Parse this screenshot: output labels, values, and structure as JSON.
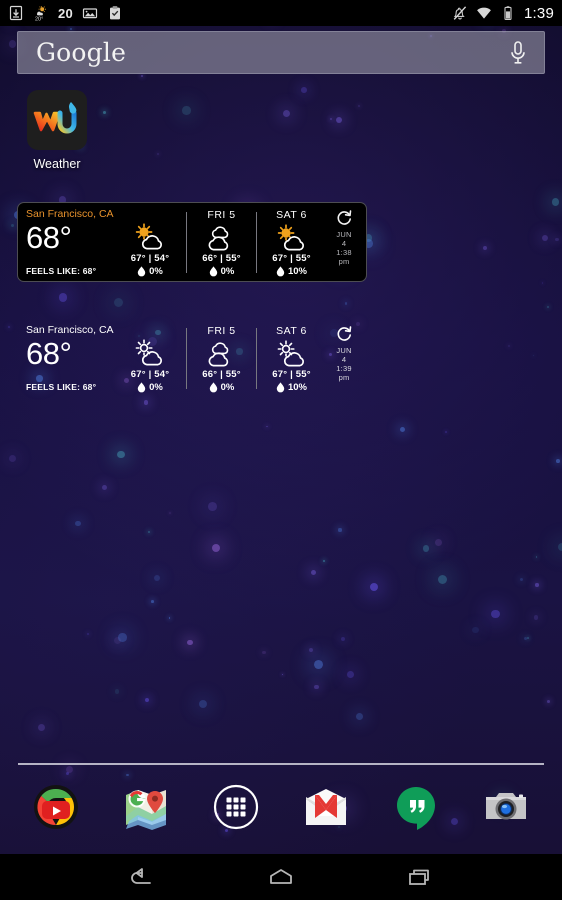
{
  "status_bar": {
    "left_icons": [
      {
        "name": "download-icon",
        "label": "download"
      },
      {
        "name": "weather-notification-icon",
        "label": "20°"
      },
      {
        "name": "notification-count",
        "label": "20"
      },
      {
        "name": "screenshot-icon",
        "label": "screenshot"
      },
      {
        "name": "clipboard-icon",
        "label": "clipboard"
      }
    ],
    "notification_count": "20",
    "weather_temp": "20°",
    "right_icons": [
      {
        "name": "silent-mode-icon",
        "label": "silent"
      },
      {
        "name": "wifi-icon",
        "label": "wifi"
      },
      {
        "name": "battery-icon",
        "label": "battery"
      }
    ],
    "clock": "1:39"
  },
  "search": {
    "brand": "Google",
    "placeholder": "Google",
    "mic_label": "voice-search"
  },
  "apps": [
    {
      "name": "weather-underground",
      "label": "Weather",
      "logo": "wu"
    }
  ],
  "widgets": [
    {
      "id": "widget-opaque",
      "style": "opaque",
      "city": "San Francisco, CA",
      "temp": "68°",
      "feels_like_label": "FEELS LIKE:",
      "feels_like_value": "68°",
      "today_icon": "partly-cloudy",
      "today_hilo": "67° | 54°",
      "today_pop": "0%",
      "refresh_label": "refresh",
      "stamp": [
        "JUN",
        "4",
        "1:38",
        "pm"
      ],
      "days": [
        {
          "name": "FRI  5",
          "icon": "cloudy",
          "hilo": "66° | 55°",
          "pop": "0%"
        },
        {
          "name": "SAT  6",
          "icon": "partly-cloudy",
          "hilo": "67° | 55°",
          "pop": "10%"
        }
      ]
    },
    {
      "id": "widget-clear",
      "style": "transparent",
      "city": "San Francisco, CA",
      "temp": "68°",
      "feels_like_label": "FEELS LIKE:",
      "feels_like_value": "68°",
      "today_icon": "partly-cloudy",
      "today_hilo": "67° | 54°",
      "today_pop": "0%",
      "refresh_label": "refresh",
      "stamp": [
        "JUN",
        "4",
        "1:39",
        "pm"
      ],
      "days": [
        {
          "name": "FRI  5",
          "icon": "cloudy",
          "hilo": "66° | 55°",
          "pop": "0%"
        },
        {
          "name": "SAT  6",
          "icon": "partly-cloudy",
          "hilo": "67° | 55°",
          "pop": "10%"
        }
      ]
    }
  ],
  "dock": [
    {
      "name": "youtube-chrome-icon",
      "label": "YouTube"
    },
    {
      "name": "maps-icon",
      "label": "Maps"
    },
    {
      "name": "all-apps-icon",
      "label": "Apps"
    },
    {
      "name": "gmail-icon",
      "label": "Gmail"
    },
    {
      "name": "hangouts-icon",
      "label": "Hangouts"
    },
    {
      "name": "camera-icon",
      "label": "Camera"
    }
  ],
  "navbar": [
    {
      "name": "back-button",
      "label": "Back"
    },
    {
      "name": "home-button",
      "label": "Home"
    },
    {
      "name": "recents-button",
      "label": "Recents"
    }
  ],
  "colors": {
    "wallpaper": "#171040",
    "widget_city_accent": "#e8922c",
    "widget_bg": "#000000",
    "sun": "#f0a21c",
    "searchbar": "#96949f"
  }
}
